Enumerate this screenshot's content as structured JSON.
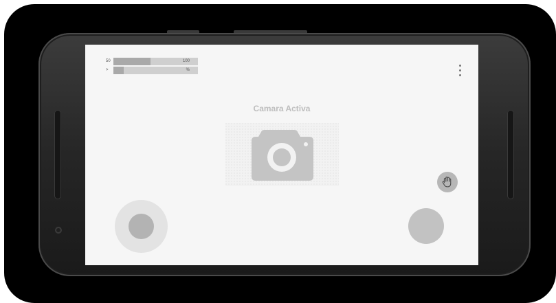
{
  "status_bars": [
    {
      "left_label": "50",
      "right_label": "100",
      "fill_fraction": 0.44
    },
    {
      "left_label": ">",
      "right_label": "%",
      "fill_fraction": 0.12
    }
  ],
  "screen": {
    "title": "Camara Activa"
  },
  "icons": {
    "menu": "more-vertical-icon",
    "camera": "camera-icon",
    "hand": "hand-icon"
  },
  "colors": {
    "screen_bg": "#f6f6f6",
    "bar_track": "#cfcfcf",
    "bar_fill": "#a9a9a9",
    "title_text": "#bdbdbd",
    "action_button": "#c2c2c2"
  }
}
